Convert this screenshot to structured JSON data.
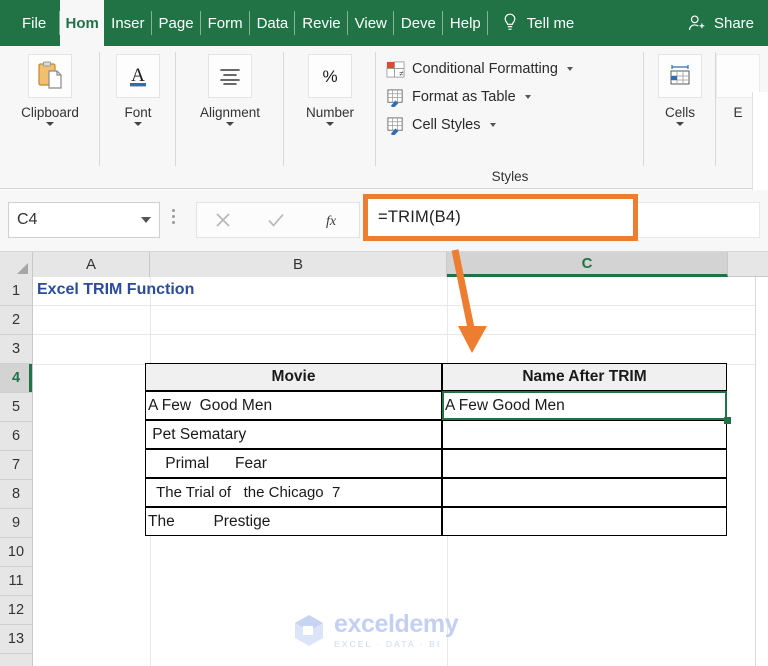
{
  "ribbon": {
    "tabs": [
      {
        "label": "File",
        "active": false
      },
      {
        "label": "Hom",
        "active": true
      },
      {
        "label": "Inser",
        "active": false
      },
      {
        "label": "Page",
        "active": false
      },
      {
        "label": "Form",
        "active": false
      },
      {
        "label": "Data",
        "active": false
      },
      {
        "label": "Revie",
        "active": false
      },
      {
        "label": "View",
        "active": false
      },
      {
        "label": "Deve",
        "active": false
      },
      {
        "label": "Help",
        "active": false
      }
    ],
    "tell_me": "Tell me",
    "share": "Share",
    "groups": [
      {
        "label": "Clipboard",
        "icon": "clipboard-icon"
      },
      {
        "label": "Font",
        "icon": "font-a-icon"
      },
      {
        "label": "Alignment",
        "icon": "alignment-icon"
      },
      {
        "label": "Number",
        "icon": "percent-icon"
      }
    ],
    "styles": {
      "caption": "Styles",
      "items": [
        {
          "label": "Conditional Formatting",
          "icon": "conditional-formatting-icon"
        },
        {
          "label": "Format as Table",
          "icon": "format-as-table-icon"
        },
        {
          "label": "Cell Styles",
          "icon": "cell-styles-icon"
        }
      ]
    },
    "cells_group": {
      "label": "Cells",
      "icon": "cells-icon"
    },
    "editing_group": {
      "label": "E",
      "icon": "editing-icon"
    }
  },
  "formula_bar": {
    "name_box_value": "C4",
    "cancel_icon": "close-icon",
    "enter_icon": "check-icon",
    "function_icon": "fx-icon",
    "formula": "=TRIM(B4)",
    "highlight_color": "#ED7D31"
  },
  "grid": {
    "columns": [
      {
        "label": "A",
        "selected": false
      },
      {
        "label": "B",
        "selected": false
      },
      {
        "label": "C",
        "selected": true
      }
    ],
    "rows": [
      "1",
      "2",
      "3",
      "4",
      "5",
      "6",
      "7",
      "8",
      "9",
      "10",
      "11",
      "12",
      "13"
    ],
    "selected_row": "4",
    "selected_cell": "C4",
    "a1_title": "Excel TRIM Function"
  },
  "table": {
    "headers": [
      "Movie",
      "Name After TRIM"
    ],
    "rows": [
      {
        "movie": "A Few  Good Men",
        "result": "A Few Good Men"
      },
      {
        "movie": " Pet Sematary",
        "result": ""
      },
      {
        "movie": "    Primal      Fear",
        "result": ""
      },
      {
        "movie": "  The Trial of   the Chicago  7",
        "result": ""
      },
      {
        "movie": "The         Prestige",
        "result": ""
      }
    ]
  },
  "watermark": {
    "name": "exceldemy",
    "tagline": "EXCEL · DATA · BI"
  }
}
